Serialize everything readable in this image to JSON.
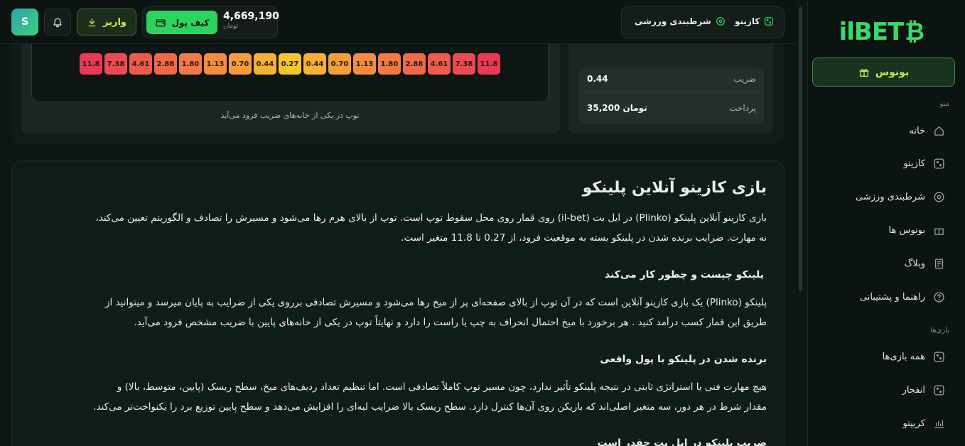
{
  "brand": {
    "logo_text": "ilBET"
  },
  "header": {
    "avatar_letter": "S",
    "deposit_label": "واریز",
    "wallet_label": "کیف پول",
    "balance": "4,669,190",
    "balance_unit": "تومان",
    "tabs": [
      {
        "label": "کازینو",
        "icon": "dice-icon"
      },
      {
        "label": "شرطبندی ورزشی",
        "icon": "target-icon"
      }
    ]
  },
  "sidebar": {
    "bonus_button": "بونوس",
    "menu_title": "منو",
    "menu_items": [
      {
        "label": "خانه",
        "icon": "home-icon"
      },
      {
        "label": "کازینو",
        "icon": "dice-icon"
      },
      {
        "label": "شرطبندی ورزشی",
        "icon": "target-icon"
      },
      {
        "label": "بونوس ها",
        "icon": "gift-icon"
      },
      {
        "label": "وبلاگ",
        "icon": "document-icon"
      },
      {
        "label": "راهنما و پشتیبانی",
        "icon": "help-icon"
      }
    ],
    "games_title": "بازی‌ها",
    "games_items": [
      {
        "label": "همه بازی‌ها",
        "icon": "dice-icon"
      },
      {
        "label": "انفجار",
        "icon": "dice-icon"
      },
      {
        "label": "کریپتو",
        "icon": "chart-icon"
      }
    ]
  },
  "game": {
    "multipliers": [
      "11.8",
      "7.38",
      "4.61",
      "2.88",
      "1.80",
      "1.13",
      "0.70",
      "0.44",
      "0.27",
      "0.44",
      "0.70",
      "1.13",
      "1.80",
      "2.88",
      "4.61",
      "7.38",
      "11.8"
    ],
    "multiplier_colors": [
      "#e83a55",
      "#ec4a52",
      "#ef5a4e",
      "#f2694a",
      "#f47a45",
      "#f58c40",
      "#f59d3b",
      "#f5b035",
      "#f6c52e",
      "#f5b035",
      "#f59d3b",
      "#f58c40",
      "#f47a45",
      "#f2694a",
      "#ef5a4e",
      "#ec4a52",
      "#e83a55"
    ],
    "caption": "توپ در یکی از خانه‌های ضریب فرود می‌آید",
    "bet": {
      "coef_label": "ضریب",
      "coef_value": "0.44",
      "payout_label": "پرداخت",
      "payout_value": "تومان 35,200"
    }
  },
  "article": {
    "title": "بازی کازینو آنلاین پلینکو",
    "intro_line1": "بازی کازینو آنلاین پلینکو (Plinko) در ایل بت (il-bet) روی قمار روی محل سقوط توپ است. توپ از بالای هرم رها می‌شود و مسیرش را تصادف و الگوریتم تعیین می‌کند،",
    "intro_line2": "نه مهارت. ضرایب برنده شدن در پلینکو بسته به موقعیت فرود، از 0.27 تا 11.8 متغیر است.",
    "h2_what": "پلینکو چیست و چطور کار می‌کند",
    "what_line1": "پلینکو (Plinko) یک بازی کازینو آنلاین است که در آن توپ از بالای صفحه‌ای پر از میخ رها می‌شود و مسیرش تصادفی برروی یکی از ضرایب به پایان میرسد و میتوانید از",
    "what_line2": "طریق این قمار کسب درآمد کنید . هر برخورد با میخ احتمال انحراف به چپ یا راست را دارد و نهایتاً توپ در یکی از خانه‌های پایین با ضریب مشخص فرود می‌آید.",
    "h2_win": "برنده شدن در پلینکو با پول واقعی",
    "win_line1": "هیچ مهارت فنی یا استراتژی ثابتی در نتیجه پلینکو تأثیر ندارد، چون مسیر توپ کاملاً تصادفی است. اما تنظیم تعداد ردیف‌های میخ، سطح ریسک (پایین، متوسط، بالا) و",
    "win_line2": "مقدار شرط در هر دور، سه متغیر اصلی‌اند که بازیکن روی آن‌ها کنترل دارد. سطح ریسک بالا ضرایب لبه‌ای را افزایش می‌دهد و سطح پایین توزیع برد را یکنواخت‌تر می‌کند.",
    "h2_next": "ضریب پلینکو در ایل بت چقدر است"
  }
}
